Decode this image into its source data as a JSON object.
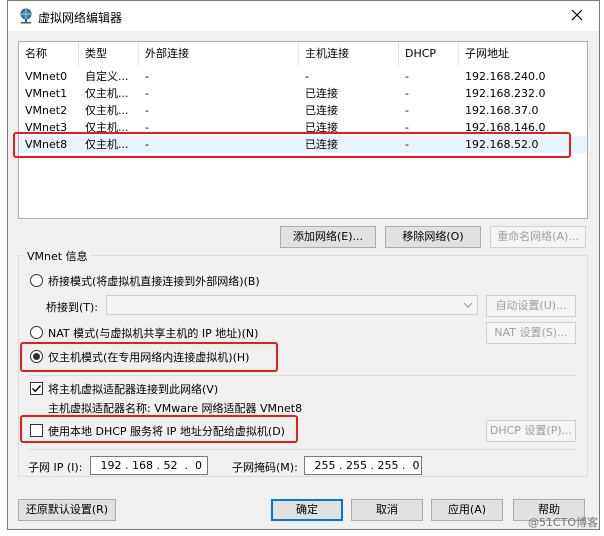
{
  "window": {
    "title": "虚拟网络编辑器",
    "close_icon": "close-icon"
  },
  "network_table": {
    "columns": [
      "名称",
      "类型",
      "外部连接",
      "主机连接",
      "DHCP",
      "子网地址"
    ],
    "rows": [
      {
        "name": "VMnet0",
        "type": "自定义...",
        "external": "-",
        "host": "-",
        "dhcp": "-",
        "subnet": "192.168.240.0"
      },
      {
        "name": "VMnet1",
        "type": "仅主机...",
        "external": "-",
        "host": "已连接",
        "dhcp": "-",
        "subnet": "192.168.232.0"
      },
      {
        "name": "VMnet2",
        "type": "仅主机...",
        "external": "-",
        "host": "已连接",
        "dhcp": "-",
        "subnet": "192.168.37.0"
      },
      {
        "name": "VMnet3",
        "type": "仅主机...",
        "external": "-",
        "host": "已连接",
        "dhcp": "-",
        "subnet": "192.168.146.0"
      },
      {
        "name": "VMnet8",
        "type": "仅主机...",
        "external": "-",
        "host": "已连接",
        "dhcp": "-",
        "subnet": "192.168.52.0"
      }
    ],
    "selected_row": "VMnet8"
  },
  "table_buttons": {
    "add": "添加网络(E)...",
    "remove": "移除网络(O)",
    "rename": "重命名网络(A)..."
  },
  "vmnet_info": {
    "title": "VMnet 信息",
    "bridge_mode": "桥接模式(将虚拟机直接连接到外部网络)(B)",
    "bridge_to_label": "桥接到(T):",
    "bridge_to_value": "",
    "auto_settings": "自动设置(U)...",
    "nat_mode": "NAT 模式(与虚拟机共享主机的 IP 地址)(N)",
    "nat_settings": "NAT 设置(S)...",
    "host_only_mode": "仅主机模式(在专用网络内连接虚拟机)(H)",
    "selected_mode": "host-only",
    "connect_adapter": "将主机虚拟适配器连接到此网络(V)",
    "connect_adapter_checked": true,
    "adapter_name": "主机虚拟适配器名称: VMware 网络适配器 VMnet8",
    "use_dhcp": "使用本地 DHCP 服务将 IP 地址分配给虚拟机(D)",
    "use_dhcp_checked": false,
    "dhcp_settings": "DHCP 设置(P)...",
    "subnet_ip_label": "子网 IP (I):",
    "subnet_ip_value": " 192 . 168 . 52  .  0",
    "subnet_mask_label": "子网掩码(M):",
    "subnet_mask_value": " 255 . 255 . 255 .  0"
  },
  "footer": {
    "restore_defaults": "还原默认设置(R)",
    "ok": "确定",
    "cancel": "取消",
    "apply": "应用(A)",
    "help": "帮助"
  },
  "watermark": "@51CTO博客",
  "colors": {
    "highlight_red": "#e02020",
    "selected_row": "#e5f3ff",
    "default_button_border": "#0078d7"
  }
}
